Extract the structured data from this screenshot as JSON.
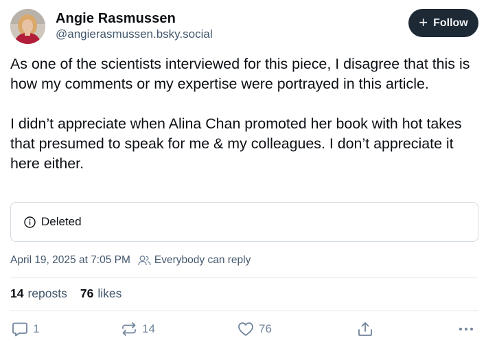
{
  "author": {
    "display_name": "Angie Rasmussen",
    "handle": "@angierasmussen.bsky.social"
  },
  "follow_button": {
    "label": "Follow"
  },
  "post": {
    "paragraphs": [
      "As one of the scientists interviewed for this piece, I disagree that this is how my comments or my expertise were portrayed in this article.",
      "I didn’t appreciate when Alina Chan promoted her book with hot takes that presumed to speak for me & my colleagues. I don’t appreciate it here either."
    ]
  },
  "quote": {
    "label": "Deleted",
    "icon": "info-icon"
  },
  "meta": {
    "timestamp": "April 19, 2025 at 7:05 PM",
    "reply_setting": "Everybody can reply"
  },
  "stats": {
    "reposts_count": "14",
    "reposts_label": "reposts",
    "likes_count": "76",
    "likes_label": "likes"
  },
  "actions": {
    "reply_count": "1",
    "repost_count": "14",
    "like_count": "76"
  },
  "colors": {
    "text_primary": "#0b0f14",
    "text_secondary": "#42576c",
    "icon_gray": "#6f839a",
    "follow_bg": "#1e2936",
    "border": "#d4dbe2"
  }
}
